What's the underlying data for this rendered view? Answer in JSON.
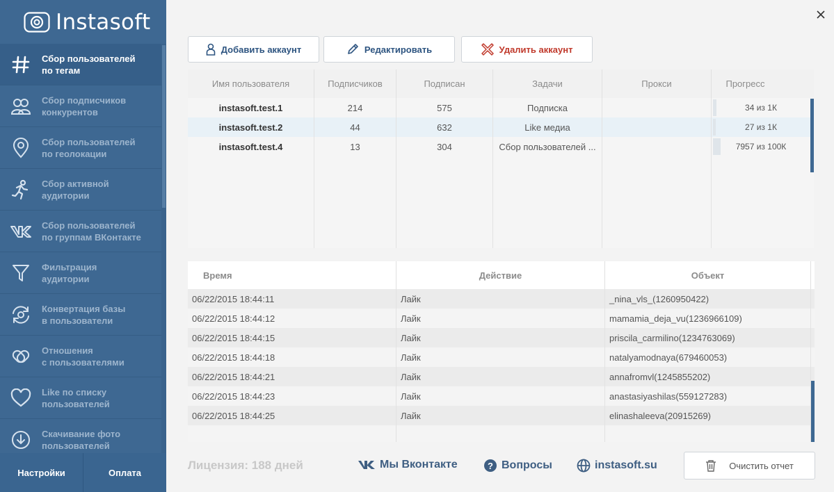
{
  "app": {
    "title": "Instasoft"
  },
  "sidebar": {
    "items": [
      {
        "label": "Сбор пользователей\nпо тегам",
        "icon": "hashtag-icon",
        "active": true
      },
      {
        "label": "Сбор подписчиков\nконкурентов",
        "icon": "users-icon"
      },
      {
        "label": "Сбор пользователей\nпо геолокации",
        "icon": "map-pin-icon"
      },
      {
        "label": "Сбор активной\nаудитории",
        "icon": "running-person-icon"
      },
      {
        "label": "Сбор пользователей\nпо группам ВКонтакте",
        "icon": "vk-icon"
      },
      {
        "label": "Фильтрация\nаудитории",
        "icon": "filter-icon"
      },
      {
        "label": "Конвертация базы\nв пользователи",
        "icon": "convert-icon"
      },
      {
        "label": "Отношения\nс пользователями",
        "icon": "relations-icon"
      },
      {
        "label": "Like по списку\nпользователей",
        "icon": "heart-icon"
      },
      {
        "label": "Скачивание фото\nпользователей",
        "icon": "download-icon"
      }
    ],
    "settings_label": "Настройки",
    "payment_label": "Оплата"
  },
  "toolbar": {
    "add_label": "Добавить аккаунт",
    "edit_label": "Редактировать",
    "delete_label": "Удалить аккаунт"
  },
  "accounts": {
    "columns": [
      "Имя пользователя",
      "Подписчиков",
      "Подписан",
      "Задачи",
      "Прокси",
      "Прогресс"
    ],
    "rows": [
      {
        "user": "instasoft.test.1",
        "followers": "214",
        "following": "575",
        "task": "Подписка",
        "proxy": "",
        "progress": "34 из 1К",
        "fraction": 0.034
      },
      {
        "user": "instasoft.test.2",
        "followers": "44",
        "following": "632",
        "task": "Like медиа",
        "proxy": "",
        "progress": "27 из 1К",
        "fraction": 0.027
      },
      {
        "user": "instasoft.test.4",
        "followers": "13",
        "following": "304",
        "task": "Сбор пользователей ...",
        "proxy": "",
        "progress": "7957 из 100К",
        "fraction": 0.08
      }
    ]
  },
  "log": {
    "columns": [
      "Время",
      "Действие",
      "Объект"
    ],
    "rows": [
      {
        "time": "06/22/2015 18:44:11",
        "action": "Лайк",
        "object": "_nina_vls_(1260950422)"
      },
      {
        "time": "06/22/2015 18:44:12",
        "action": "Лайк",
        "object": "mamamia_deja_vu(1236966109)"
      },
      {
        "time": "06/22/2015 18:44:15",
        "action": "Лайк",
        "object": "priscila_carmilino(1234763069)"
      },
      {
        "time": "06/22/2015 18:44:18",
        "action": "Лайк",
        "object": "natalyamodnaya(679460053)"
      },
      {
        "time": "06/22/2015 18:44:21",
        "action": "Лайк",
        "object": "annafromvl(1245855202)"
      },
      {
        "time": "06/22/2015 18:44:23",
        "action": "Лайк",
        "object": "anastasiyashilas(559127283)"
      },
      {
        "time": "06/22/2015 18:44:25",
        "action": "Лайк",
        "object": "elinashaleeva(20915269)"
      }
    ]
  },
  "footer": {
    "license": "Лицензия: 188 дней",
    "vk_label": "Мы Вконтакте",
    "faq_label": "Вопросы",
    "site_label": "instasoft.su",
    "clear_label": "Очистить отчет"
  },
  "colors": {
    "sidebar": "#3e6892",
    "accent": "#2d5480",
    "danger": "#c0392b"
  }
}
